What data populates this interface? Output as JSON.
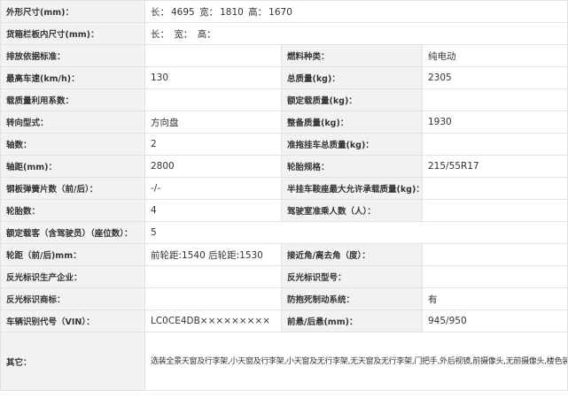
{
  "rows": [
    {
      "label": "外形尺寸(mm)：",
      "length_label": "长：",
      "length": "4695",
      "width_label": "宽：",
      "width": "1810",
      "height_label": "高：",
      "height": "1670"
    },
    {
      "label": "货箱栏板内尺寸(mm)：",
      "length_label": "长：",
      "width_label": "宽：",
      "height_label": "高："
    },
    {
      "l1": "排放依据标准：",
      "v1": "",
      "l2": "燃料种类：",
      "v2": "纯电动"
    },
    {
      "l1": "最高车速(km/h)：",
      "v1": "130",
      "l2": "总质量(kg)：",
      "v2": "2305"
    },
    {
      "l1": "载质量利用系数：",
      "v1": "",
      "l2": "额定载质量(kg)：",
      "v2": ""
    },
    {
      "l1": "转向型式：",
      "v1": "方向盘",
      "l2": "整备质量(kg)：",
      "v2": "1930"
    },
    {
      "l1": "轴数：",
      "v1": "2",
      "l2": "准拖挂车总质量(kg)：",
      "v2": ""
    },
    {
      "l1": "轴距(mm)：",
      "v1": "2800",
      "l2": "轮胎规格：",
      "v2": "215/55R17"
    },
    {
      "l1": "钢板弹簧片数（前/后）：",
      "v1": "-/-",
      "l2": "半挂车鞍座最大允许承载质量(kg)：",
      "v2": ""
    },
    {
      "l1": "轮胎数：",
      "v1": "4",
      "l2": "驾驶室准乘人数（人）：",
      "v2": ""
    },
    {
      "label": "额定载客（含驾驶员）（座位数）：",
      "value": "5"
    },
    {
      "l1": "轮距（前/后)mm：",
      "v1": "前轮距:1540 后轮距:1530",
      "l2": "接近角/离去角（度）：",
      "v2": ""
    },
    {
      "l1": "反光标识生产企业：",
      "v1": "",
      "l2": "反光标识型号：",
      "v2": ""
    },
    {
      "l1": "反光标识商标：",
      "v1": "",
      "l2": "防抱死制动系统：",
      "v2": "有"
    },
    {
      "l1": "车辆识别代号（VIN）：",
      "v1": "LC0CE4DB×××××××××",
      "l2": "前悬/后悬(mm)：",
      "v2": "945/950"
    }
  ],
  "other": {
    "label": "其它：",
    "text": "选装全景天窗及行李架,小天窗及行李架,小天窗及无行李架,无天窗及无行李架,门把手,外后视镜,前摄像头,无前摄像头,楼色装饰件,侧窗装饰件,前保左右装饰件,后摄像头,不带ACC前格栅,无后雷达,前雷达,内后视镜.ABS型号:IPB,IPB生产企业:博世汽车部件（苏州）有限公司,储能装置种类:磷酸铁锂蓄电池,单体生产企业:重庆弗迪电池有限公司,总成生产企业:重庆弗迪电池有限公司,驱动电机类型:永磁同步电机,型号:BYD-1814TZ-XS-D,生产企业:长沙市比亚迪汽车有限公司,驱动电机峰值功率为100kW,驱动电机额定功率为35kW,允许外接充电,可在全国销售."
  }
}
